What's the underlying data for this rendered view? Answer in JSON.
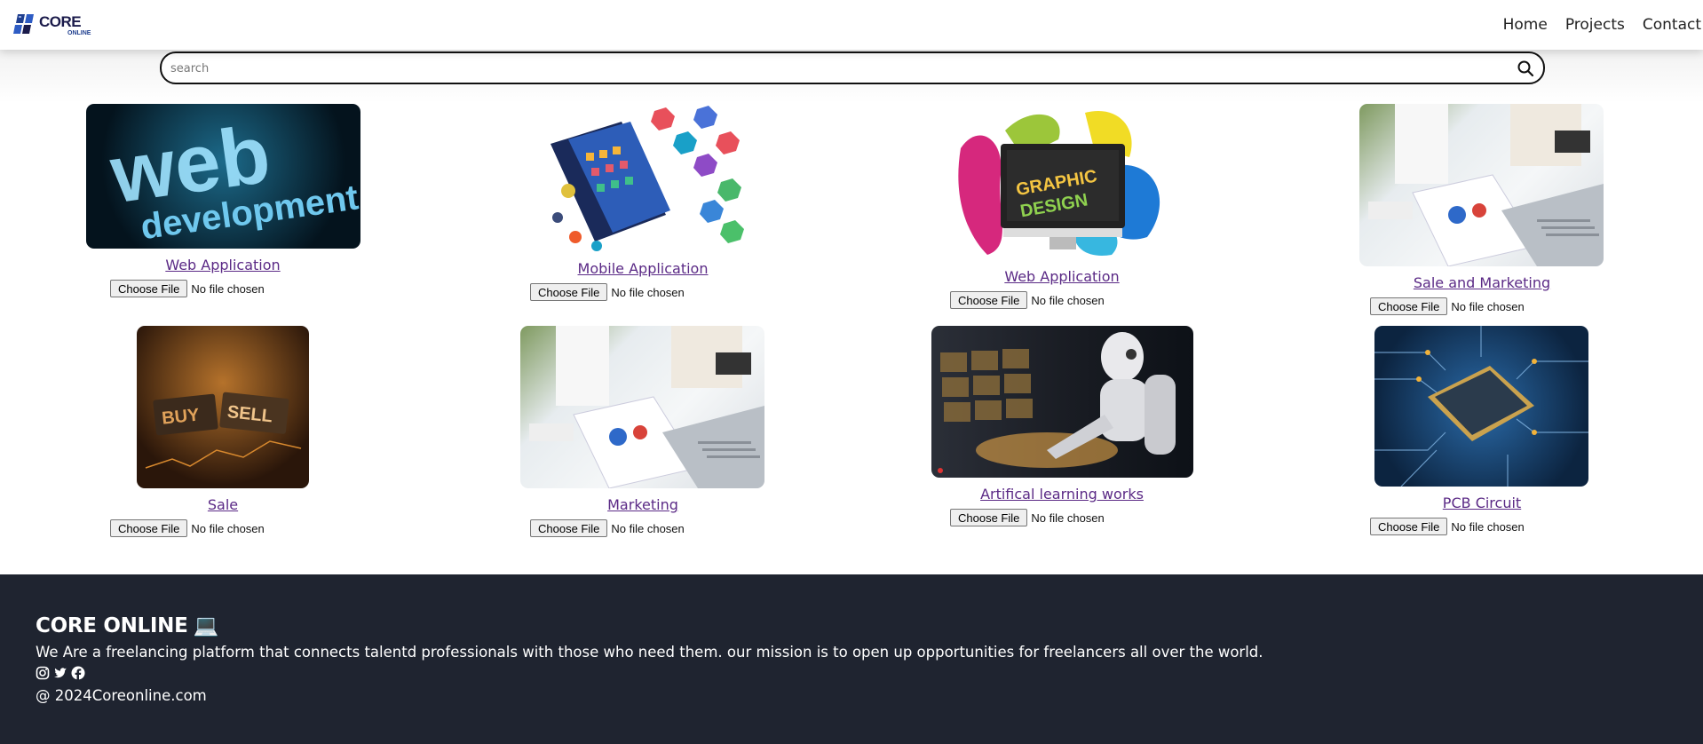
{
  "header": {
    "logo_text": "CORE",
    "logo_sub": "ONLINE",
    "nav": [
      {
        "label": "Home"
      },
      {
        "label": "Projects"
      },
      {
        "label": "Contact"
      }
    ]
  },
  "search": {
    "placeholder": "search",
    "icon": "search-icon"
  },
  "cards": [
    {
      "title": "Web Application",
      "file_button": "Choose File",
      "file_status": "No file chosen",
      "image": "web-development-image"
    },
    {
      "title": "Mobile Application",
      "file_button": "Choose File",
      "file_status": "No file chosen",
      "image": "mobile-apps-image"
    },
    {
      "title": "Web Application",
      "file_button": "Choose File",
      "file_status": "No file chosen",
      "image": "graphic-design-image"
    },
    {
      "title": "Sale and Marketing",
      "file_button": "Choose File",
      "file_status": "No file chosen",
      "image": "business-charts-image"
    },
    {
      "title": "Sale",
      "file_button": "Choose File",
      "file_status": "No file chosen",
      "image": "buy-sell-image"
    },
    {
      "title": "Marketing",
      "file_button": "Choose File",
      "file_status": "No file chosen",
      "image": "business-charts-image"
    },
    {
      "title": "Artifical learning works",
      "file_button": "Choose File",
      "file_status": "No file chosen",
      "image": "robot-ai-image"
    },
    {
      "title": "PCB Circuit",
      "file_button": "Choose File",
      "file_status": "No file chosen",
      "image": "pcb-chip-image"
    }
  ],
  "footer": {
    "brand": "CORE ONLINE",
    "laptop_emoji": "💻",
    "description": "We Are a freelancing platform that connects talentd professionals with those who need them. our mission is to open up opportunities for freelancers all over the world.",
    "social": [
      "instagram-icon",
      "twitter-icon",
      "facebook-icon"
    ],
    "copyright": "@ 2024Coreonline.com"
  },
  "colors": {
    "footer_bg": "#1f2430",
    "link": "#5b2a86",
    "logo": "#1b1b4b"
  }
}
